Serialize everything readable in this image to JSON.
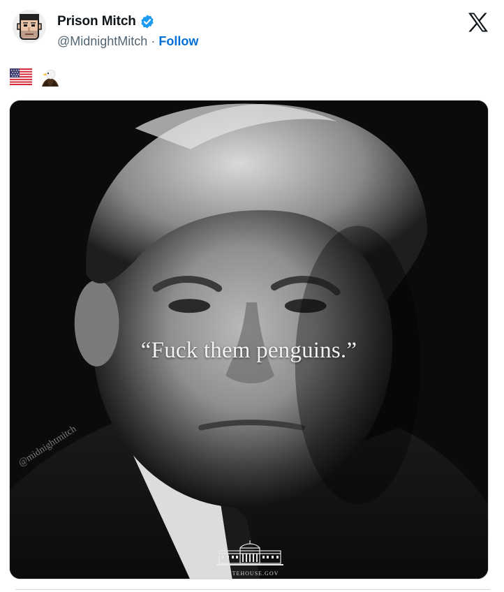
{
  "author": {
    "display_name": "Prison Mitch",
    "handle": "@MidnightMitch",
    "separator": "·",
    "follow_label": "Follow",
    "verified": true
  },
  "platform_icon": "x-logo-icon",
  "tweet": {
    "emojis": [
      "us-flag-emoji",
      "eagle-emoji"
    ]
  },
  "media": {
    "quote": "“Fuck them penguins.”",
    "watermark": "@midnightmitch",
    "site_text": "WHITEHOUSE.GOV"
  },
  "colors": {
    "link_blue": "#006fd6",
    "verified_blue": "#1d9bf0",
    "secondary_text": "#536471"
  }
}
